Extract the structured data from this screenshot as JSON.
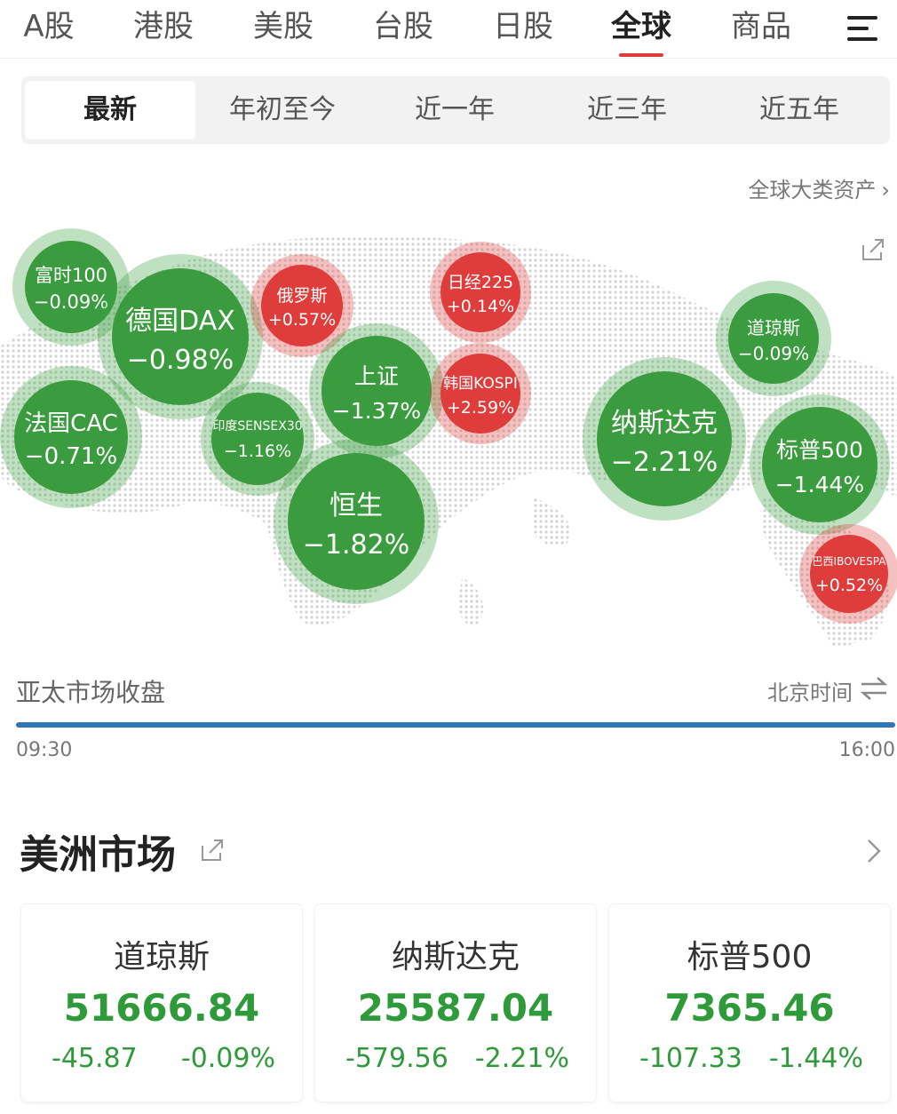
{
  "topnav": {
    "tabs": [
      {
        "label": "A股"
      },
      {
        "label": "港股"
      },
      {
        "label": "美股"
      },
      {
        "label": "台股"
      },
      {
        "label": "日股"
      },
      {
        "label": "全球",
        "active": true
      },
      {
        "label": "商品"
      }
    ],
    "menu_icon": "hamburger-menu-icon"
  },
  "periods": [
    "最新",
    "年初至今",
    "近一年",
    "近三年",
    "近五年"
  ],
  "active_period": "最新",
  "assets_link": "全球大类资产",
  "bubbles": [
    {
      "name": "富时100",
      "change": "−0.09%",
      "status": "down"
    },
    {
      "name": "德国DAX",
      "change": "−0.98%",
      "status": "down"
    },
    {
      "name": "俄罗斯",
      "change": "+0.57%",
      "status": "up"
    },
    {
      "name": "日经225",
      "change": "+0.14%",
      "status": "up"
    },
    {
      "name": "道琼斯",
      "change": "−0.09%",
      "status": "down"
    },
    {
      "name": "法国CAC",
      "change": "−0.71%",
      "status": "down"
    },
    {
      "name": "印度SENSEX30",
      "change": "−1.16%",
      "status": "down"
    },
    {
      "name": "上证",
      "change": "−1.37%",
      "status": "down"
    },
    {
      "name": "韩国KOSPI",
      "change": "+2.59%",
      "status": "up"
    },
    {
      "name": "纳斯达克",
      "change": "−2.21%",
      "status": "down"
    },
    {
      "name": "标普500",
      "change": "−1.44%",
      "status": "down"
    },
    {
      "name": "恒生",
      "change": "−1.82%",
      "status": "down"
    },
    {
      "name": "巴西IBOVESPA",
      "change": "+0.52%",
      "status": "up"
    }
  ],
  "session": {
    "title": "亚太市场收盘",
    "timezone": "北京时间",
    "start": "09:30",
    "end": "16:00",
    "progress": 1.0
  },
  "americas": {
    "title": "美洲市场",
    "cards": [
      {
        "name": "道琼斯",
        "price": "51666.84",
        "change": "-45.87",
        "pct": "-0.09%"
      },
      {
        "name": "纳斯达克",
        "price": "25587.04",
        "change": "-579.56",
        "pct": "-2.21%"
      },
      {
        "name": "标普500",
        "price": "7365.46",
        "change": "-107.33",
        "pct": "-1.44%"
      }
    ]
  },
  "colors": {
    "up": "#df3c3c",
    "down": "#3a9c3e",
    "accent": "#e03a3a",
    "progress": "#2f77b5"
  }
}
